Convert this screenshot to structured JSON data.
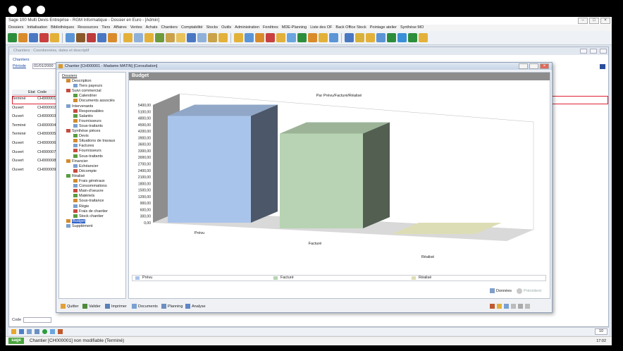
{
  "app_title": "Sage 100 Multi Devis Entreprise - RGM Informatique - Dossier en Euro - [Admin]",
  "menu": [
    "Dossiers",
    "Initialisation",
    "Bibliothèques",
    "Ressources",
    "Tiers",
    "Affaires",
    "Ventes",
    "Achats",
    "Chantiers",
    "Comptabilité",
    "Stocks",
    "Outils",
    "Administration",
    "Fenêtres",
    "MDE-Planning",
    "Liste des OF",
    "Back Office Stock",
    "Pointage atelier",
    "Synthèse MO"
  ],
  "mdi_window": {
    "title": "Chantiers : Coordonnées, dates et descriptif",
    "label_chantiers": "Chantiers",
    "label_periode": "Période",
    "periode_value": "01/01/2000",
    "col_etat": "Etat",
    "col_code": "Code",
    "rows": [
      {
        "etat": "Terminé",
        "code": "CH000001"
      },
      {
        "etat": "Ouvert",
        "code": "CH000002"
      },
      {
        "etat": "Ouvert",
        "code": "CH000003"
      },
      {
        "etat": "Terminé",
        "code": "CH000004"
      },
      {
        "etat": "Terminé",
        "code": "CH000005"
      },
      {
        "etat": "Ouvert",
        "code": "CH000006"
      },
      {
        "etat": "Ouvert",
        "code": "CH000007"
      },
      {
        "etat": "Ouvert",
        "code": "CH000008"
      },
      {
        "etat": "Ouvert",
        "code": "CH000009"
      }
    ],
    "label_code": "Code",
    "page_count": "10"
  },
  "dialog": {
    "title": "Chantier [CH000001 - Madame MATIN] [Consultation]",
    "tree_root": "Dossiers",
    "tree": [
      {
        "label": "Description",
        "level": 1
      },
      {
        "label": "Tiers payeurs",
        "level": 2
      },
      {
        "label": "Suivi commercial",
        "level": 1
      },
      {
        "label": "Calendrier",
        "level": 2
      },
      {
        "label": "Documents associés",
        "level": 2
      },
      {
        "label": "Intervenants",
        "level": 1
      },
      {
        "label": "Responsables",
        "level": 2
      },
      {
        "label": "Salariés",
        "level": 2
      },
      {
        "label": "Fournisseurs",
        "level": 2
      },
      {
        "label": "Sous-traitants",
        "level": 2
      },
      {
        "label": "Synthèse pièces",
        "level": 1
      },
      {
        "label": "Devis",
        "level": 2
      },
      {
        "label": "Situations de travaux",
        "level": 2
      },
      {
        "label": "Factures",
        "level": 2
      },
      {
        "label": "Fournisseurs",
        "level": 2
      },
      {
        "label": "Sous-traitants",
        "level": 2
      },
      {
        "label": "Financier",
        "level": 1
      },
      {
        "label": "Echéancier",
        "level": 2
      },
      {
        "label": "Décompte",
        "level": 2
      },
      {
        "label": "Réalisé",
        "level": 1
      },
      {
        "label": "Frais généraux",
        "level": 2
      },
      {
        "label": "Consommations",
        "level": 2
      },
      {
        "label": "Main-d'oeuvre",
        "level": 2
      },
      {
        "label": "Matériels",
        "level": 2
      },
      {
        "label": "Sous-traitance",
        "level": 2
      },
      {
        "label": "Régie",
        "level": 2
      },
      {
        "label": "Frais de chantier",
        "level": 2
      },
      {
        "label": "Stock chantier",
        "level": 2
      },
      {
        "label": "Budget",
        "level": 1,
        "selected": true
      },
      {
        "label": "Supplément",
        "level": 1
      }
    ],
    "section_title": "Budget",
    "buttons": {
      "donnees": "Données",
      "precedent": "Précédent"
    },
    "bottom_buttons": [
      "Quitter",
      "Valider",
      "Imprimer",
      "Documents",
      "Planning",
      "Analyse"
    ]
  },
  "chart_data": {
    "type": "bar",
    "title": "Par Prévu/Facturé/Réalisé",
    "categories": [
      "Prévu",
      "Facturé",
      "Réalisé"
    ],
    "values": [
      4900,
      4350,
      0
    ],
    "colors": [
      "#a9c4ea",
      "#b7d3b3",
      "#ddddb5"
    ],
    "y_ticks": [
      "5400,00",
      "5100,00",
      "4800,00",
      "4500,00",
      "4200,00",
      "3900,00",
      "3600,00",
      "3300,00",
      "3000,00",
      "2700,00",
      "2400,00",
      "2100,00",
      "1800,00",
      "1500,00",
      "1200,00",
      "900,00",
      "600,00",
      "300,00",
      "0,00"
    ],
    "ylim": [
      0,
      5400
    ],
    "legend": [
      "Prévu",
      "Facturé",
      "Réalisé"
    ],
    "legend_position": "bottom",
    "view": "3d"
  },
  "status_bar": {
    "text": "Chantier [CH000001] non modifiable (Terminé)",
    "time": "17:02"
  }
}
